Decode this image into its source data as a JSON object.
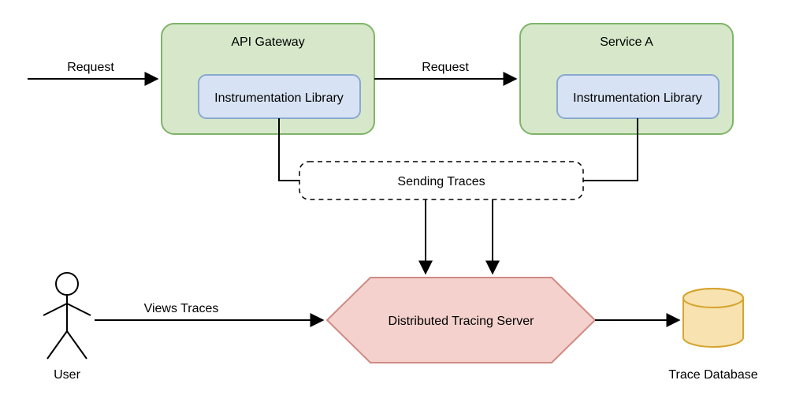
{
  "nodes": {
    "api_gateway": {
      "label": "API Gateway"
    },
    "service_a": {
      "label": "Service A"
    },
    "instr_lib_1": {
      "label": "Instrumentation Library"
    },
    "instr_lib_2": {
      "label": "Instrumentation Library"
    },
    "sending_traces": {
      "label": "Sending Traces"
    },
    "tracing_server": {
      "label": "Distributed Tracing Server"
    },
    "trace_db": {
      "label": "Trace Database"
    },
    "user": {
      "label": "User"
    }
  },
  "edges": {
    "request_1": {
      "label": "Request"
    },
    "request_2": {
      "label": "Request"
    },
    "views_traces": {
      "label": "Views Traces"
    }
  },
  "colors": {
    "green_fill": "#d6e8c9",
    "green_stroke": "#7fb36a",
    "blue_fill": "#d7e3f4",
    "blue_stroke": "#8aa8d0",
    "pink_fill": "#f4d1cc",
    "pink_stroke": "#cf8b83",
    "db_fill": "#f7e2b0",
    "db_stroke": "#d6a42f",
    "line": "#000000"
  }
}
